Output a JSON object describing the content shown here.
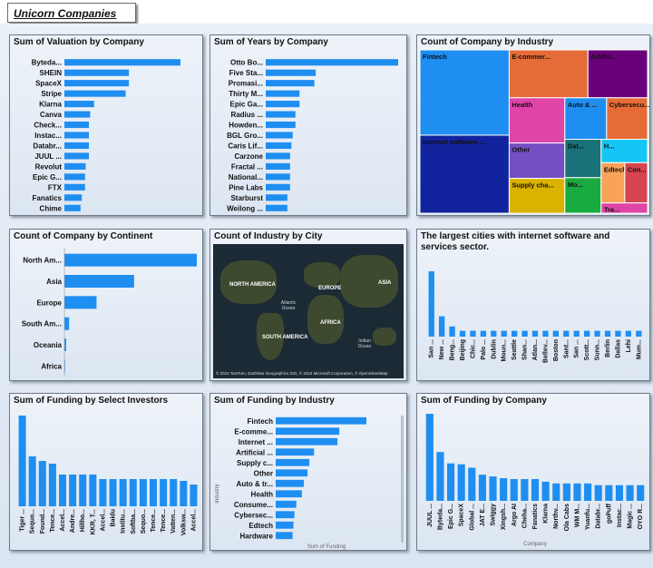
{
  "page_title": "Unicorn Companies",
  "chart_data": [
    {
      "id": "valuation",
      "type": "bar",
      "orientation": "horizontal",
      "title": "Sum of Valuation by Company",
      "categories": [
        "Byteda...",
        "SHEIN",
        "SpaceX",
        "Stripe",
        "Klarna",
        "Canva",
        "Check...",
        "Instac...",
        "Databr...",
        "JUUL ...",
        "Revolut",
        "Epic G...",
        "FTX",
        "Fanatics",
        "Chime"
      ],
      "values": [
        180,
        100,
        100,
        95,
        46,
        40,
        38,
        38,
        38,
        38,
        33,
        32,
        32,
        27,
        25
      ],
      "color": "#1f8ef1"
    },
    {
      "id": "years",
      "type": "bar",
      "orientation": "horizontal",
      "title": "Sum of Years by Company",
      "categories": [
        "Otto Bo...",
        "Five Sta...",
        "Promasi...",
        "Thirty M...",
        "Epic Ga...",
        "Radius ...",
        "Howden...",
        "BGL Gro...",
        "Caris Lif...",
        "Carzone",
        "Fractal ...",
        "National...",
        "Pine Labs",
        "Starburst",
        "Weilong ..."
      ],
      "values": [
        98,
        37,
        36,
        25,
        25,
        22,
        22,
        20,
        19,
        18,
        18,
        18,
        18,
        16,
        16
      ],
      "color": "#1f8ef1"
    },
    {
      "id": "industry_treemap",
      "type": "treemap",
      "title": "Count of Company by Industry",
      "items": [
        {
          "name": "Fintech",
          "value": 224,
          "color": "#1f8ef1"
        },
        {
          "name": "Internet software ...",
          "value": 205,
          "color": "#12239e"
        },
        {
          "name": "E-commer...",
          "value": 111,
          "color": "#e66c37"
        },
        {
          "name": "Artifici...",
          "value": 84,
          "color": "#6b007b"
        },
        {
          "name": "Health",
          "value": 74,
          "color": "#e044a7"
        },
        {
          "name": "Other",
          "value": 58,
          "color": "#744ec2"
        },
        {
          "name": "Dat...",
          "value": 41,
          "color": "#197278"
        },
        {
          "name": "Mo...",
          "value": 38,
          "color": "#1aab40"
        },
        {
          "name": "H...",
          "value": 32,
          "color": "#15c6f4"
        },
        {
          "name": "Supply cha...",
          "value": 57,
          "color": "#d9b300"
        },
        {
          "name": "Auto & ...",
          "value": 51,
          "color": "#1f8ef1"
        },
        {
          "name": "Con...",
          "value": 27,
          "color": "#d64550"
        },
        {
          "name": "Cybersecu...",
          "value": 50,
          "color": "#e66c37"
        },
        {
          "name": "Edtech",
          "value": 28,
          "color": "#f8a25a"
        },
        {
          "name": "Tra...",
          "value": 14,
          "color": "#e044a7"
        }
      ]
    },
    {
      "id": "continent",
      "type": "bar",
      "orientation": "horizontal",
      "title": "Count of Company by Continent",
      "categories": [
        "North Am...",
        "Asia",
        "Europe",
        "South Am...",
        "Oceania",
        "Africa"
      ],
      "values": [
        589,
        310,
        143,
        21,
        8,
        3
      ],
      "color": "#1f8ef1"
    },
    {
      "id": "cities",
      "type": "bar",
      "orientation": "vertical",
      "title": "The largest cities with internet software and services sector.",
      "categories": [
        "San ...",
        "New ...",
        "Beng...",
        "Beijing",
        "Chic...",
        "Palo ...",
        "Dublin",
        "Moun...",
        "Seattle",
        "Shan...",
        "Atlan...",
        "Bellev...",
        "Boston",
        "Sant...",
        "San ...",
        "Scott...",
        "Sunn...",
        "Berlin",
        "Dallas",
        "Lehi",
        "Mum..."
      ],
      "values": [
        45,
        14,
        7,
        4,
        4,
        4,
        4,
        4,
        4,
        4,
        4,
        4,
        4,
        4,
        4,
        4,
        4,
        4,
        4,
        4,
        4
      ],
      "color": "#1f8ef1"
    },
    {
      "id": "investors",
      "type": "bar",
      "orientation": "vertical",
      "title": "Sum of Funding by Select Investors",
      "categories": [
        "Tiger ...",
        "Sequo...",
        "Found...",
        "Tence...",
        "Accel...",
        "Andre...",
        "Hillho...",
        "KKR, T...",
        "Accel...",
        "Baidu",
        "Institu...",
        "Softba...",
        "Sequo...",
        "Tence...",
        "Tence...",
        "Vatten...",
        "Volksw...",
        "Accel..."
      ],
      "values": [
        100,
        55,
        50,
        47,
        35,
        35,
        35,
        35,
        30,
        30,
        30,
        30,
        30,
        30,
        30,
        30,
        28,
        24
      ],
      "color": "#1f8ef1"
    },
    {
      "id": "funding_industry",
      "type": "bar",
      "orientation": "horizontal",
      "title": "Sum of Funding by Industry",
      "categories": [
        "Fintech",
        "E-comme...",
        "Internet ...",
        "Artificial ...",
        "Supply c...",
        "Other",
        "Auto & tr...",
        "Health",
        "Consume...",
        "Cybersec...",
        "Edtech",
        "Hardware"
      ],
      "values": [
        97,
        68,
        66,
        41,
        36,
        34,
        30,
        28,
        22,
        20,
        19,
        18
      ],
      "xlabel": "Sum of Funding",
      "ylabel": "Industry",
      "color": "#1f8ef1"
    },
    {
      "id": "funding_company",
      "type": "bar",
      "orientation": "vertical",
      "title": "Sum of Funding by Company",
      "categories": [
        "JUUL ...",
        "Byteda...",
        "Epic G...",
        "SpaceX",
        "Global ...",
        "JAT E...",
        "Swiggy",
        "Xingsh...",
        "Argo AI",
        "Cheha...",
        "Fanatics",
        "Klarna",
        "Northv...",
        "Ola Cabs",
        "WM M...",
        "Yuanfu...",
        "Databr...",
        "goPuff",
        "Instac...",
        "Magic ...",
        "OYO R..."
      ],
      "values": [
        100,
        56,
        43,
        42,
        38,
        30,
        28,
        26,
        25,
        25,
        25,
        22,
        20,
        20,
        20,
        20,
        18,
        18,
        18,
        18,
        18
      ],
      "xlabel": "Company",
      "color": "#1f8ef1"
    }
  ],
  "map": {
    "title": "Count of Industry by City",
    "labels": {
      "north_america": "NORTH AMERICA",
      "europe": "EUROPE",
      "asia": "ASIA",
      "atlantic": "Atlantic Ocean",
      "africa": "AFRICA",
      "south_america": "SOUTH AMERICA",
      "indian": "Indian Ocean"
    },
    "attribution": "© 2024 TomTom, Earthstar Geographics SIO, © 2024 Microsoft Corporation, © OpenStreetMap",
    "logo": "Microsoft Bing"
  }
}
